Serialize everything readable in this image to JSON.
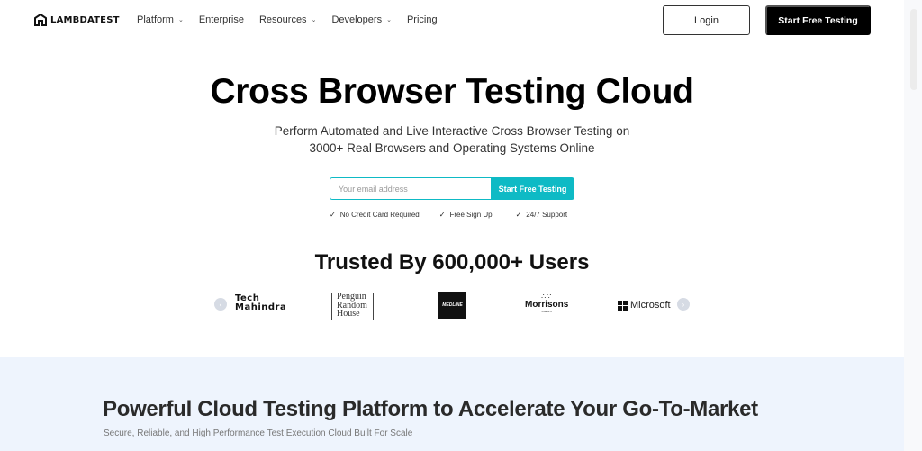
{
  "header": {
    "brand": "LAMBDATEST",
    "nav": [
      {
        "label": "Platform",
        "has_dropdown": true
      },
      {
        "label": "Enterprise",
        "has_dropdown": false
      },
      {
        "label": "Resources",
        "has_dropdown": true
      },
      {
        "label": "Developers",
        "has_dropdown": true
      },
      {
        "label": "Pricing",
        "has_dropdown": false
      }
    ],
    "login_label": "Login",
    "start_label": "Start Free Testing"
  },
  "hero": {
    "title": "Cross Browser Testing Cloud",
    "subtitle_line1": "Perform Automated and Live Interactive Cross Browser Testing on",
    "subtitle_line2": "3000+ Real Browsers and Operating Systems Online",
    "email_placeholder": "Your email address",
    "email_value": "",
    "signup_label": "Start Free Testing",
    "perks": [
      "No Credit Card Required",
      "Free Sign Up",
      "24/7 Support"
    ]
  },
  "trusted": {
    "title": "Trusted By 600,000+ Users",
    "logos": [
      {
        "name": "Tech Mahindra",
        "line1": "Tech",
        "line2": "Mahindra"
      },
      {
        "name": "Penguin Random House",
        "line1": "Penguin",
        "line2": "Random",
        "line3": "House"
      },
      {
        "name": "Medline",
        "text": "MEDLINE"
      },
      {
        "name": "Morrisons",
        "text": "Morrisons",
        "tagline": "makes it"
      },
      {
        "name": "Microsoft",
        "text": "Microsoft"
      }
    ]
  },
  "section2": {
    "title": "Powerful Cloud Testing Platform to Accelerate Your Go-To-Market",
    "subtitle": "Secure, Reliable, and High Performance Test Execution Cloud Built For Scale"
  },
  "colors": {
    "accent": "#0ebac5",
    "section_bg": "#eef4fd",
    "primary_button": "#000000"
  }
}
